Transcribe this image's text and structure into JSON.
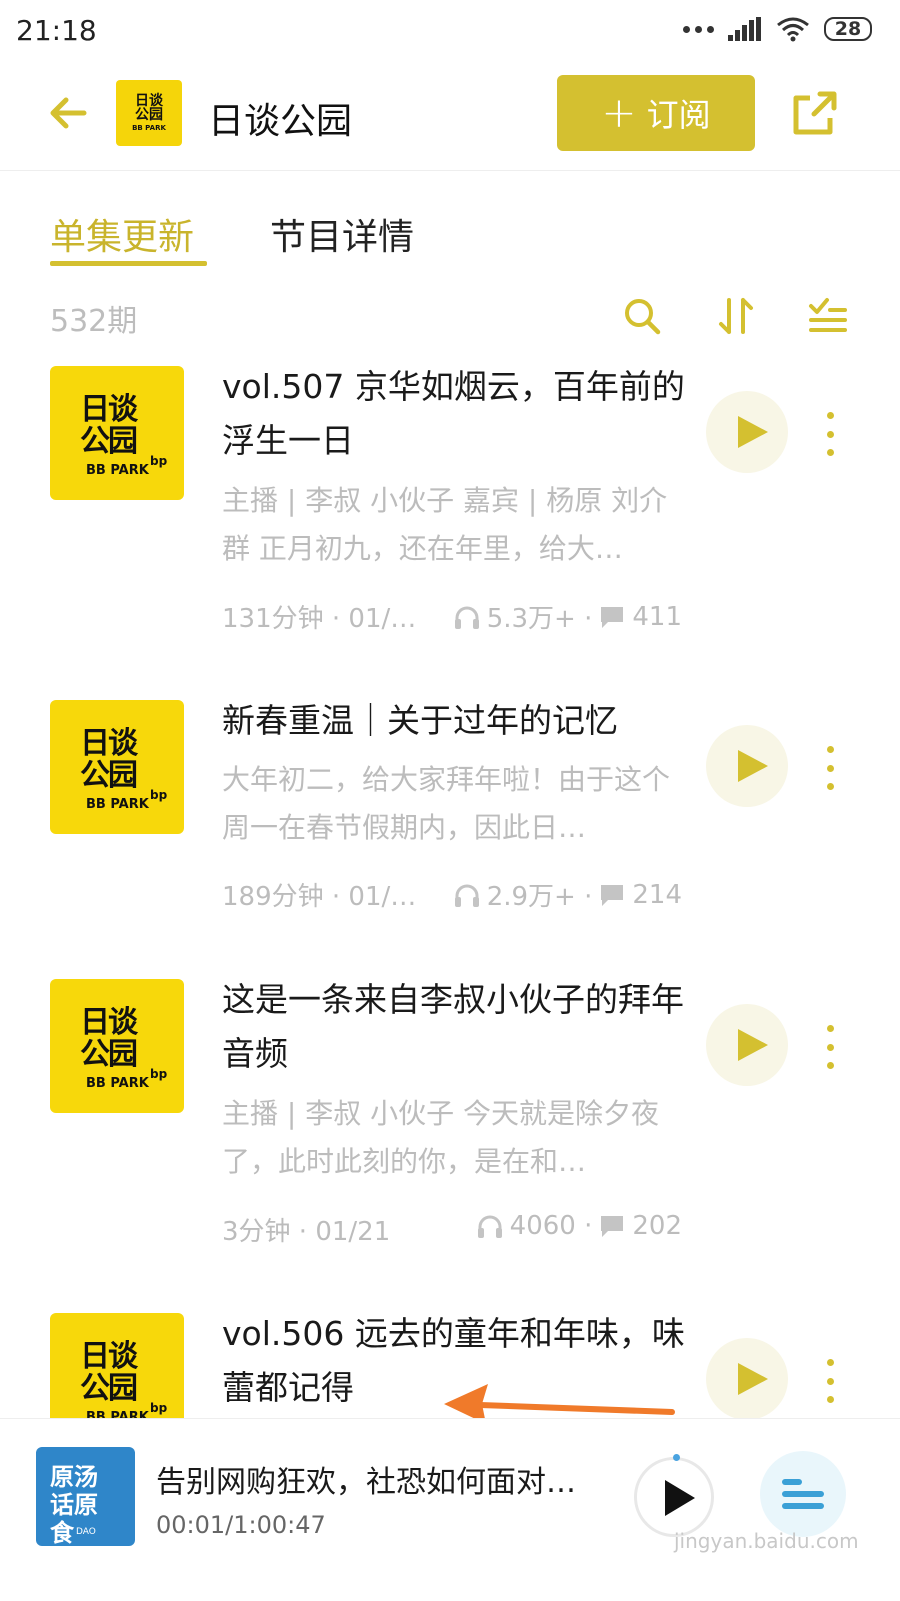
{
  "status": {
    "time": "21:18",
    "battery": "28"
  },
  "header": {
    "logo_line1": "日谈",
    "logo_line2": "公园",
    "logo_sub": "BB PARK",
    "title": "日谈公园",
    "subscribe_label": "订阅",
    "subscribe_plus": "+"
  },
  "tabs": [
    {
      "label": "单集更新"
    },
    {
      "label": "节目详情"
    }
  ],
  "toolbar": {
    "episode_count": "532期"
  },
  "cover_art": {
    "line1": "日谈",
    "line2": "公园",
    "sub": "BB PARK",
    "mark": "bp"
  },
  "episodes": [
    {
      "title": "vol.507 京华如烟云，百年前的浮生一日",
      "desc": "主播 | 李叔 小伙子 嘉宾 | 杨原 刘介群 正月初九，还在年里，给大…",
      "duration": "131分钟 · 01/…",
      "plays": "5.3万+ ·",
      "comments": "411"
    },
    {
      "title": "新春重温｜关于过年的记忆",
      "desc": "大年初二，给大家拜年啦！由于这个周一在春节假期内，因此日…",
      "duration": "189分钟 · 01/…",
      "plays": "2.9万+ ·",
      "comments": "214"
    },
    {
      "title": "这是一条来自李叔小伙子的拜年音频",
      "desc": "主播 | 李叔 小伙子 今天就是除夕夜了，此时此刻的你，是在和…",
      "duration": "3分钟 · 01/21",
      "plays": "4060 ·",
      "comments": "202"
    },
    {
      "title": "vol.506 远去的童年和年味，味蕾都记得"
    }
  ],
  "player": {
    "cover_text": "原汤话原食",
    "cover_sub": "DAO",
    "title": "告别网购狂欢，社恐如何面对…",
    "time": "00:01/1:00:47"
  },
  "watermark": "jingyan.baidu.com",
  "colors": {
    "accent": "#d4c030",
    "cover_yellow": "#f7d80b",
    "muted_text": "#bcbcbc",
    "arrow": "#f07a2a"
  }
}
